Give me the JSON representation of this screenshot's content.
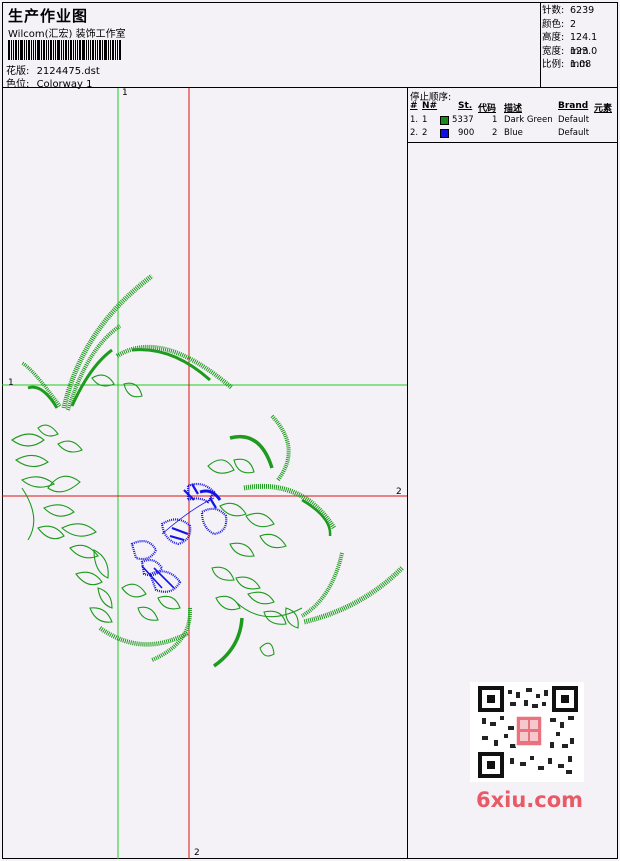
{
  "header": {
    "title": "生产作业图",
    "studio": "Wilcom(汇宏) 装饰工作室",
    "design_label": "花版:",
    "design_value": "2124475.dst",
    "color_label": "色位:",
    "color_value": "Colorway 1"
  },
  "info": [
    {
      "k": "针数:",
      "v": "6239"
    },
    {
      "k": "颜色:",
      "v": "2"
    },
    {
      "k": "高度:",
      "v": "124.1 mm"
    },
    {
      "k": "宽度:",
      "v": "123.0 mm"
    },
    {
      "k": "比例:",
      "v": "1.08"
    }
  ],
  "stop_sequence": {
    "title": "停止顺序:",
    "headers": [
      "#",
      "N#",
      "St.",
      "代码",
      "描述",
      "Brand",
      "元素"
    ],
    "rows": [
      {
        "idx": "1.",
        "n": "1",
        "stitches": "5337",
        "code": "1",
        "desc": "Dark Green",
        "brand": "Default",
        "color": "#1b8a1b"
      },
      {
        "idx": "2.",
        "n": "2",
        "stitches": "900",
        "code": "2",
        "desc": "Blue",
        "brand": "Default",
        "color": "#1010e0"
      }
    ]
  },
  "markers": {
    "v1": "1",
    "h1": "1",
    "h2": "2",
    "v2": "2"
  },
  "watermark": "6xiu.com",
  "colors": {
    "green": "#1e9a1e",
    "blue": "#1414e6",
    "guide_green": "#22cc22",
    "guide_red": "#dd1111"
  }
}
